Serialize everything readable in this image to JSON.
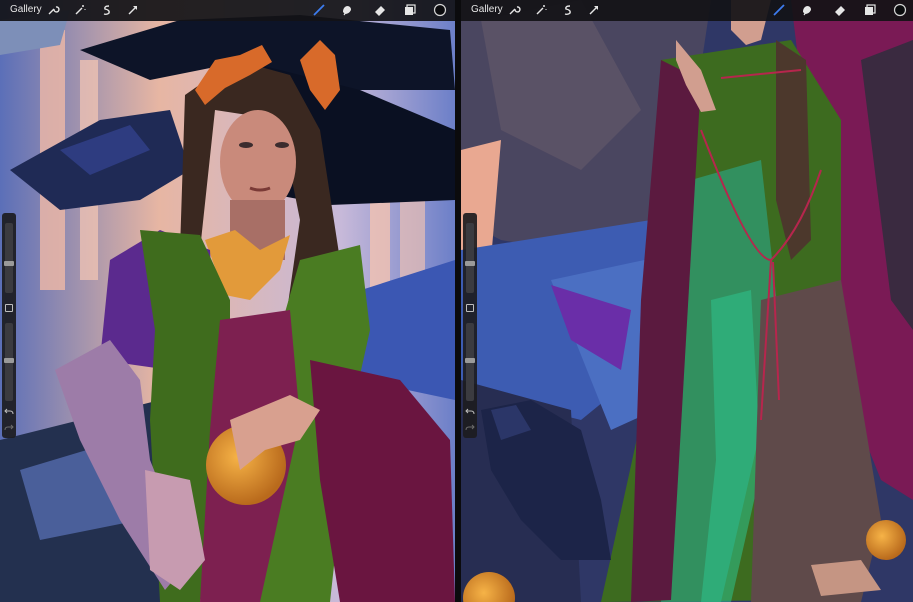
{
  "left_screen": {
    "toolbar": {
      "gallery_label": "Gallery",
      "left_tools": [
        "wrench-icon",
        "magic-wand-icon",
        "selection-icon",
        "transform-arrow-icon"
      ],
      "right_tools": [
        "brush-icon",
        "smudge-icon",
        "eraser-icon",
        "layers-icon",
        "color-circle-icon"
      ],
      "active_tool_color": "#3d7cf0"
    },
    "sidebar": {
      "brush_size_level": 0.75,
      "opacity_level": 0.35
    }
  },
  "right_screen": {
    "toolbar": {
      "gallery_label": "Gallery",
      "left_tools": [
        "wrench-icon",
        "magic-wand-icon",
        "selection-icon",
        "transform-arrow-icon"
      ],
      "right_tools": [
        "brush-icon",
        "smudge-icon",
        "eraser-icon",
        "layers-icon",
        "color-circle-icon"
      ],
      "active_tool_color": "#3d7cf0"
    },
    "sidebar": {
      "brush_size_level": 0.75,
      "opacity_level": 0.35
    }
  }
}
